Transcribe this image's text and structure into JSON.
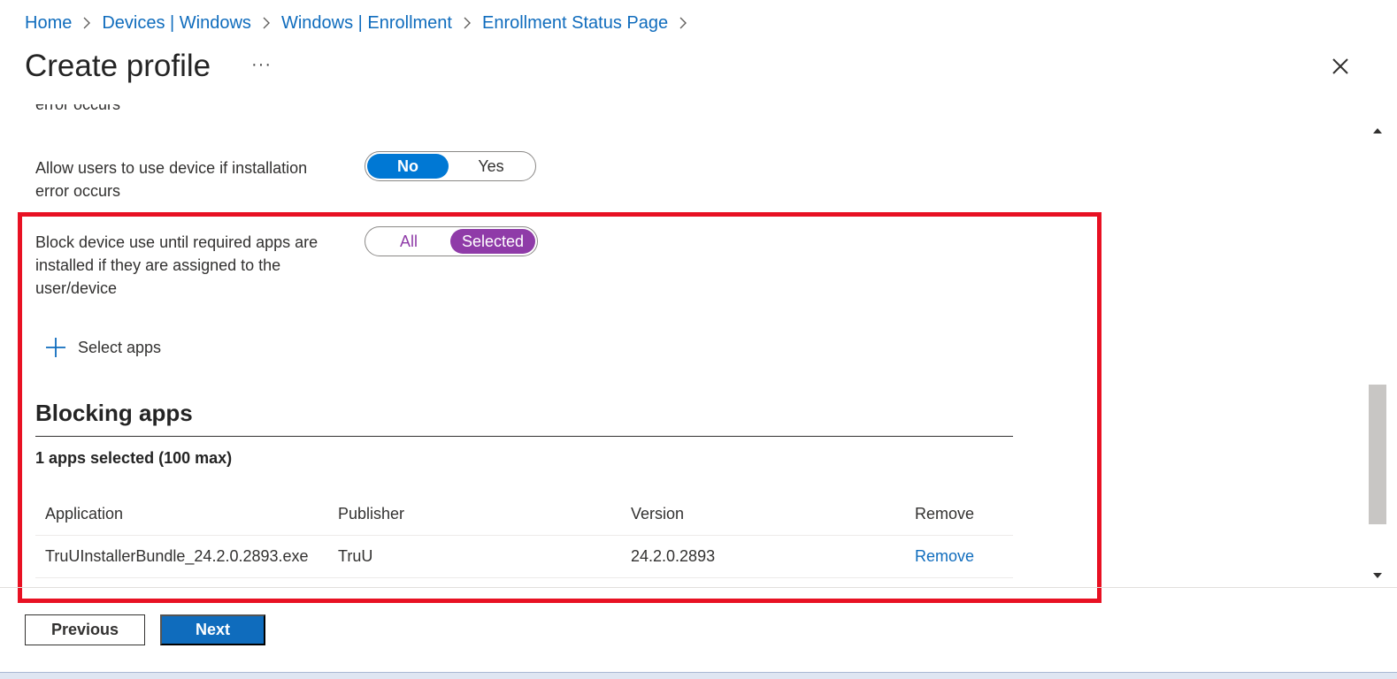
{
  "breadcrumb": [
    "Home",
    "Devices | Windows",
    "Windows | Enrollment",
    "Enrollment Status Page"
  ],
  "page": {
    "title": "Create profile",
    "more_label": "···"
  },
  "content": {
    "cut_text": "error occurs",
    "setting1": {
      "label": "Allow users to use device if installation error occurs",
      "options": [
        "No",
        "Yes"
      ],
      "selected": "No"
    },
    "setting2": {
      "label": "Block device use until required apps are installed if they are assigned to the user/device",
      "options": [
        "All",
        "Selected"
      ],
      "selected": "Selected"
    },
    "select_apps_label": "Select apps",
    "section_title": "Blocking apps",
    "count_text": "1 apps selected (100 max)",
    "table": {
      "headers": [
        "Application",
        "Publisher",
        "Version",
        "Remove"
      ],
      "rows": [
        [
          "TruUInstallerBundle_24.2.0.2893.exe",
          "TruU",
          "24.2.0.2893",
          "Remove"
        ]
      ]
    }
  },
  "footer": {
    "previous_label": "Previous",
    "next_label": "Next"
  },
  "icons": [
    "chevron-right-icon",
    "more-icon",
    "close-icon",
    "plus-icon"
  ],
  "colors": {
    "accent": "#0078d4",
    "link": "#0f6cbd",
    "purple": "#8f3ba8",
    "highlight_box": "#e81123"
  }
}
